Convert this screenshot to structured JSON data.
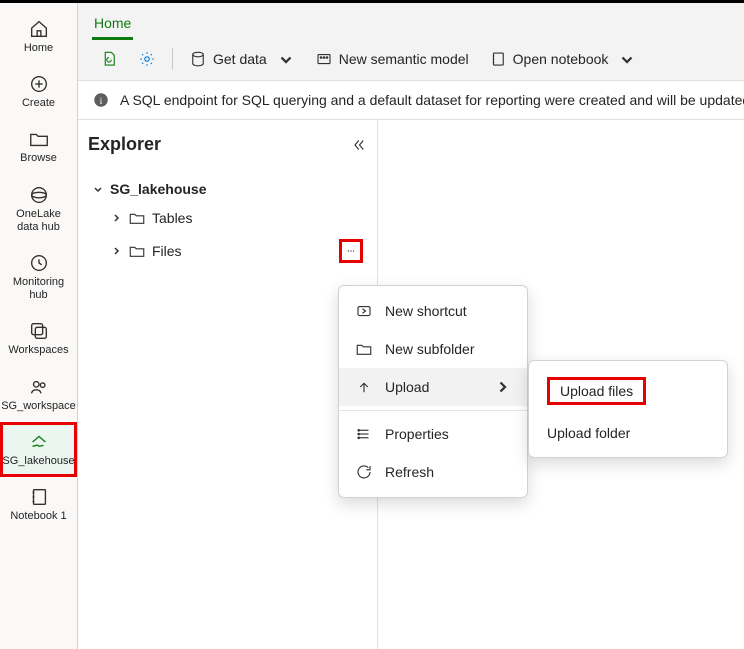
{
  "rail": [
    {
      "label": "Home"
    },
    {
      "label": "Create"
    },
    {
      "label": "Browse"
    },
    {
      "label": "OneLake data hub"
    },
    {
      "label": "Monitoring hub"
    },
    {
      "label": "Workspaces"
    },
    {
      "label": "SG_workspace"
    },
    {
      "label": "SG_lakehouse"
    },
    {
      "label": "Notebook 1"
    }
  ],
  "tabs": {
    "home": "Home"
  },
  "cmdbar": {
    "get_data": "Get data",
    "new_model": "New semantic model",
    "open_notebook": "Open notebook"
  },
  "info": "A SQL endpoint for SQL querying and a default dataset for reporting were created and will be updated wit",
  "explorer": {
    "title": "Explorer",
    "root": "SG_lakehouse",
    "children": [
      "Tables",
      "Files"
    ]
  },
  "context_menu": {
    "new_shortcut": "New shortcut",
    "new_subfolder": "New subfolder",
    "upload": "Upload",
    "properties": "Properties",
    "refresh": "Refresh"
  },
  "submenu": {
    "upload_files": "Upload files",
    "upload_folder": "Upload folder"
  }
}
